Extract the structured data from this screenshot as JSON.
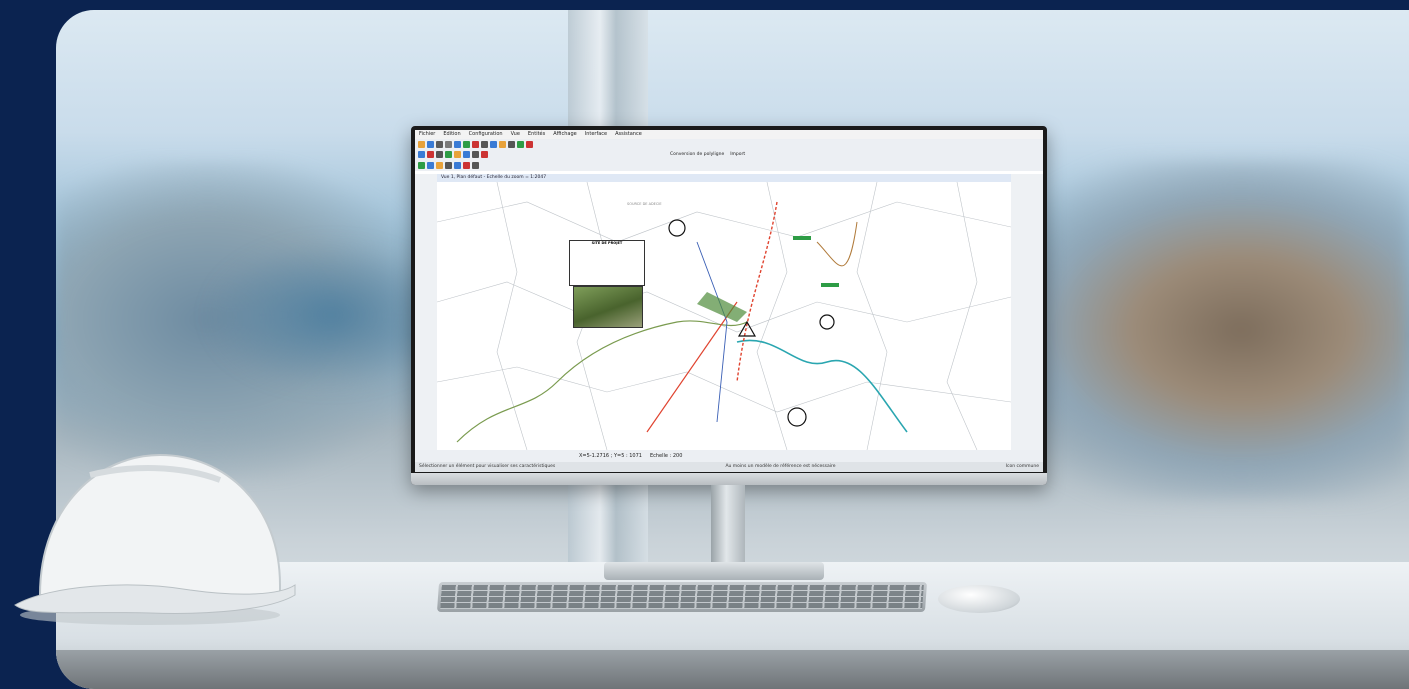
{
  "app": {
    "menu": [
      "Fichier",
      "Edition",
      "Configuration",
      "Vue",
      "Entités",
      "Affichage",
      "Interface",
      "Assistance"
    ],
    "window_title": "Vue 1, Plan défaut - Echelle du zoom = 1:2047",
    "toolbar_label": "Conversion de polyligne",
    "toolbar_label2": "Import",
    "status": {
      "coords": "X=5-1.2716 ; Y=5 : 1071",
      "scale_label": "Echelle : 200",
      "hint": "Sélectionner un élément pour visualiser ses caractéristiques",
      "reference": "Au moins un modèle de référence est nécessaire",
      "layer": "Icon commune"
    },
    "legend_title": "SITE DE PROJET",
    "map_label": "SOURCE DE ADECIE"
  },
  "colors": {
    "page_bg": "#0b2350",
    "monitor": "#1a1a1a",
    "river": "#2aa6b0",
    "red_line": "#e0432f",
    "path_brown": "#b07a3a"
  },
  "icons": [
    "hard-hat",
    "keyboard",
    "mouse",
    "north-arrow-icon",
    "warning-triangle-icon"
  ]
}
